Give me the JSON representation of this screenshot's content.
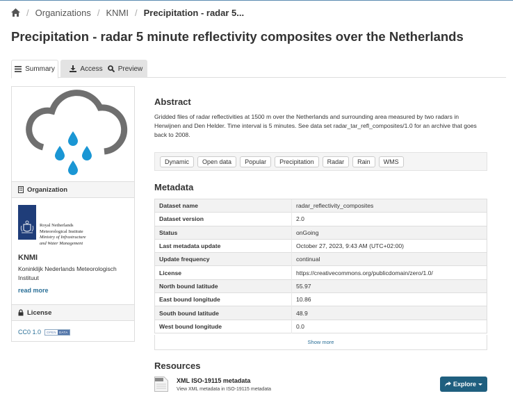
{
  "breadcrumb": {
    "home_icon": "home-icon",
    "items": [
      "Organizations",
      "KNMI"
    ],
    "current": "Precipitation - radar 5..."
  },
  "page": {
    "title": "Precipitation - radar 5 minute reflectivity composites over the Netherlands"
  },
  "tabs": [
    {
      "label": "Summary",
      "icon": "list-icon",
      "active": true
    },
    {
      "label": "Access",
      "icon": "download-icon",
      "active": false
    },
    {
      "label": "Preview",
      "icon": "search-icon",
      "active": false
    }
  ],
  "sidebar": {
    "dataset_icon": "rain-cloud-icon",
    "organization_heading": "Organization",
    "organization_icon": "building-icon",
    "org_logo": {
      "line1": "Royal Netherlands",
      "line2": "Meteorological Institute",
      "line3": "Ministry of Infrastructure",
      "line4": "and Water Management"
    },
    "org_short_name": "KNMI",
    "org_full_name": "Koninklijk Nederlands Meteorologisch Instituut",
    "read_more": "read more",
    "license_heading": "License",
    "license_icon": "lock-icon",
    "license_link": "CC0 1.0",
    "open_data_badge": {
      "left": "OPEN",
      "right": "DATA"
    }
  },
  "abstract": {
    "heading": "Abstract",
    "text": "Gridded files of radar reflectivities at 1500 m over the Netherlands and surrounding area measured by two radars in Herwijnen and Den Helder. Time interval is 5 minutes. See data set radar_tar_refl_composites/1.0 for an archive that goes back to 2008."
  },
  "tags": [
    "Dynamic",
    "Open data",
    "Popular",
    "Precipitation",
    "Radar",
    "Rain",
    "WMS"
  ],
  "metadata": {
    "heading": "Metadata",
    "rows": [
      {
        "key": "Dataset name",
        "value": "radar_reflectivity_composites"
      },
      {
        "key": "Dataset version",
        "value": "2.0"
      },
      {
        "key": "Status",
        "value": "onGoing"
      },
      {
        "key": "Last metadata update",
        "value": "October 27, 2023, 9:43 AM (UTC+02:00)"
      },
      {
        "key": "Update frequency",
        "value": "continual"
      },
      {
        "key": "License",
        "value": "https://creativecommons.org/publicdomain/zero/1.0/"
      },
      {
        "key": "North bound latitude",
        "value": "55.97"
      },
      {
        "key": "East bound longitude",
        "value": "10.86"
      },
      {
        "key": "South bound latitude",
        "value": "48.9"
      },
      {
        "key": "West bound longitude",
        "value": "0.0"
      }
    ],
    "show_more": "Show more"
  },
  "resources": {
    "heading": "Resources",
    "items": [
      {
        "icon": "data-file-icon",
        "title": "XML ISO-19115 metadata",
        "description": "View XML metadata in ISO-19115 metadata",
        "button_label": "Explore",
        "button_icon": "share-icon"
      }
    ]
  },
  "colors": {
    "accent": "#2a6f97",
    "button": "#1f5f7f",
    "raindrop": "#1a96d4",
    "cloud": "#6f6f6f",
    "org_logo_bar": "#1f3d79"
  }
}
